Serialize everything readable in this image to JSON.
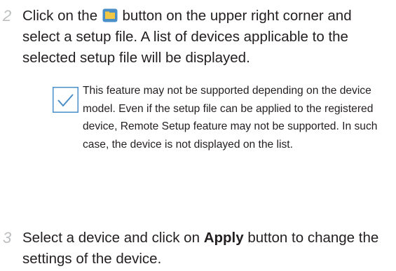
{
  "step2": {
    "number": "2",
    "text_before_icon": "Click on the ",
    "icon": "folder-icon",
    "text_after_icon": " button on the upper right corner and select a setup file. A list of devices applicable to the selected setup file will be displayed."
  },
  "note": {
    "icon": "checkmark-icon",
    "text": "This feature may not be supported depending on the device model. Even if the setup file can be applied to the registered device, Remote Setup feature may not be supported. In such case, the device is not displayed on the list."
  },
  "step3": {
    "number": "3",
    "text_before_bold": "Select a device and click on ",
    "bold_text": "Apply",
    "text_after_bold": " button to change the settings of the device."
  },
  "colors": {
    "step_number": "#bcbec0",
    "icon_blue": "#4b8fc9",
    "icon_yellow": "#f2c744",
    "text": "#231f20"
  }
}
